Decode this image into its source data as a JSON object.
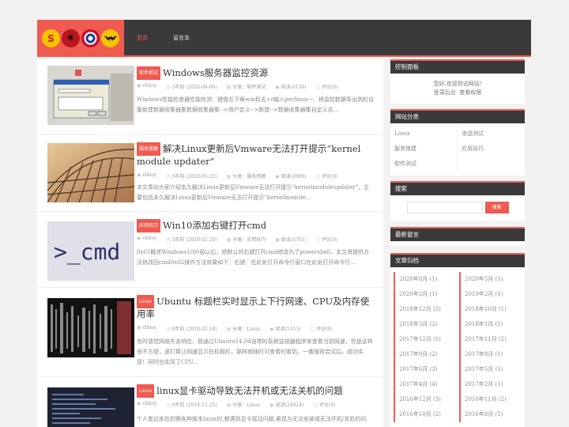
{
  "nav": {
    "items": [
      "首页",
      "留言本"
    ]
  },
  "posts": [
    {
      "tag": "软件测试",
      "title": "Windows服务器监控资源",
      "author": "vbboy",
      "time": "5年前 (2020-08-06)",
      "category": "分类：软件测试",
      "views": "阅读(4150)",
      "comments": "评论(0)",
      "excerpt": "Windows性能检查器性能检测：键盘左下角win标志+r输入perfmon→、将监控数据导出到的设备新建数据收集器集数据收集器集-->用户定义-->新建-->数据收集器集自定义名..."
    },
    {
      "tag": "服务搭建",
      "title": "解决Linux更新后Vmware无法打开提示“kernel module updater”",
      "author": "vbboy",
      "time": "5年前 (2020-05-22)",
      "category": "分类：服务搭建",
      "views": "阅读(4989)",
      "comments": "评论(0)",
      "excerpt": "本文章向大家介绍本久解决Linux更新后Vmware无法打开提示“kernelmoduleupdater”，主要包括永久解决Linux更新后Vmware无法打开提示“kernelmodule..."
    },
    {
      "tag": "应用技巧",
      "title": "Win10添加右键打开cmd",
      "author": "vbboy",
      "time": "5年前 (2020-02-20)",
      "category": "分类：应用技巧",
      "views": "阅读(4761)",
      "comments": "评论(0)",
      "excerpt": "0x01概述Windows10升级以后，把默认的右键打开cmd修改为了powershell，本文将提供方法修改回cmd0x02操作方法效果如下：右键：在此处打开命令行窗口在此处打开命令行..."
    },
    {
      "tag": "Linux",
      "title": "Ubuntu 标题栏实时显示上下行网速、CPU及内存使用率",
      "author": "vbboy",
      "time": "6年前 (2019-02-18)",
      "category": "分类：Linux",
      "views": "阅读(5353)",
      "comments": "评论(0)",
      "excerpt": "有时感觉网络失去响应，就通过Ubuntu14.04自带的系统监视器程序来查看当前网速，但是这样很不方便，遂打算让网速显示在标题栏，那样就随时可查看的看到。一番搜索尝试后，成功实现！同时也实现了CPU..."
    },
    {
      "tag": "Linux",
      "title": "linux显卡驱动导致无法开机或无法关机的问题",
      "author": "vbboy",
      "time": "6年前 (2018-12-25)",
      "category": "分类：Linux",
      "views": "阅读(24924)",
      "comments": "评论(0)",
      "excerpt": "个人笔记本在折腾各种版本linux时,都遇到显卡驱动问题,表现为无法安装或无法开机/关机的问"
    }
  ],
  "thumb_text": {
    "cmd": ">_cmd"
  },
  "sidebar": {
    "control": {
      "title": "控制面板",
      "welcome": "您好,欢迎到访网站!",
      "login": "登录后台",
      "perm": "查看权限"
    },
    "categories": {
      "title": "网站分类",
      "items": [
        "Linux",
        "渗透测试",
        "服务搭建",
        "应用技巧",
        "软件测试"
      ]
    },
    "search": {
      "title": "搜索",
      "button": "搜索",
      "placeholder": ""
    },
    "comments": {
      "title": "最新留言"
    },
    "archives": {
      "title": "文章归档",
      "items": [
        "2020年8月 (1)",
        "2020年5月 (1)",
        "2020年2月 (1)",
        "2019年2月 (1)",
        "2018年12月 (2)",
        "2018年10月 (1)",
        "2018年3月 (2)",
        "2018年1月 (1)",
        "2017年12月 (1)",
        "2017年11月 (2)",
        "2017年9月 (2)",
        "2017年8月 (1)",
        "2017年6月 (3)",
        "2017年5月 (1)",
        "2017年4月 (4)",
        "2017年2月 (1)",
        "2016年12月 (3)",
        "2016年11月 (2)",
        "2016年10月 (2)",
        "2016年8月 (5)"
      ]
    }
  },
  "colors": {
    "accent": "#ef5b50",
    "dark": "#3a3a3a"
  }
}
